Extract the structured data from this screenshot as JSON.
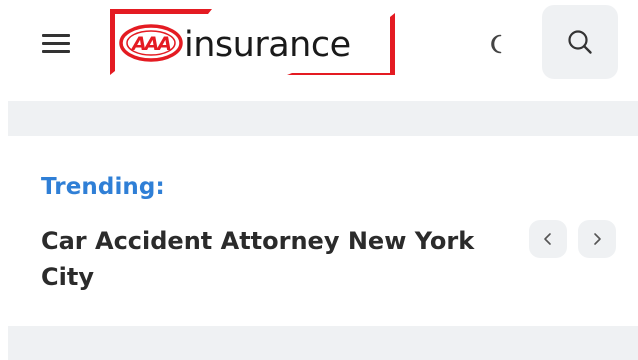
{
  "header": {
    "menu_icon": "hamburger-menu-icon",
    "logo_text": "insurance",
    "logo_mark": "AAA",
    "theme_icon": "moon-icon",
    "search_icon": "search-icon"
  },
  "trending": {
    "label": "Trending:",
    "title": "Car Accident Attorney New York City",
    "prev_icon": "chevron-left-icon",
    "next_icon": "chevron-right-icon"
  },
  "colors": {
    "brand_red": "#e41b22",
    "trending_blue": "#2f7fd6",
    "band_gray": "#eff1f3",
    "text_dark": "#2b2b2b"
  }
}
